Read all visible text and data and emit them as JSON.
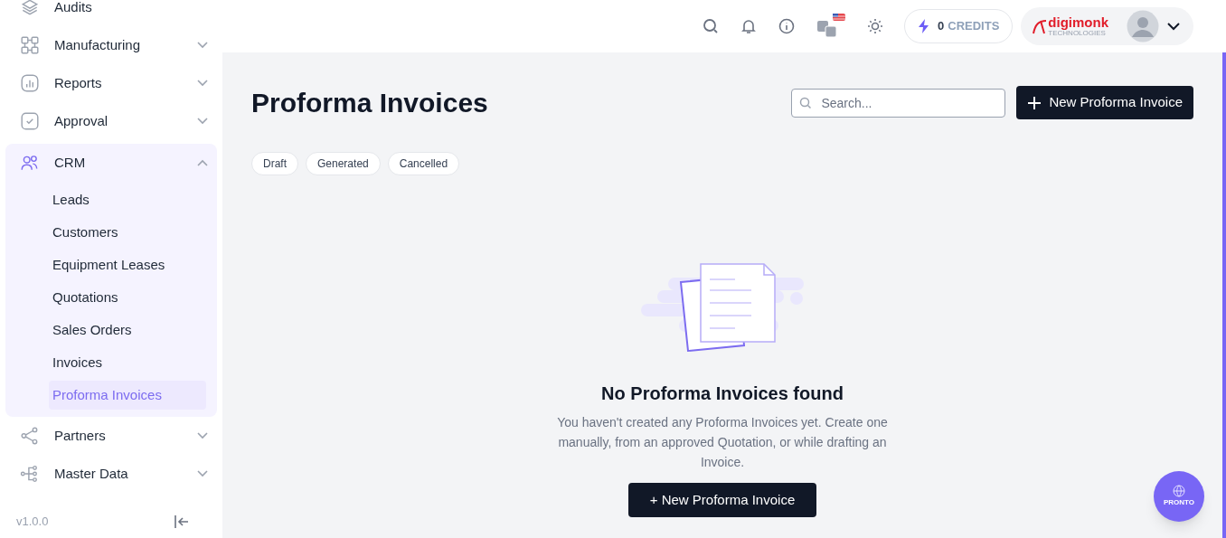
{
  "sidebar": {
    "items": [
      {
        "label": "Audits",
        "kind": "layers"
      },
      {
        "label": "Manufacturing",
        "kind": "grid",
        "expanded": false
      },
      {
        "label": "Reports",
        "kind": "chart",
        "expanded": false
      },
      {
        "label": "Approval",
        "kind": "check",
        "expanded": false
      },
      {
        "label": "CRM",
        "kind": "users",
        "expanded": true,
        "children": [
          {
            "label": "Leads",
            "selected": false
          },
          {
            "label": "Customers",
            "selected": false
          },
          {
            "label": "Equipment Leases",
            "selected": false
          },
          {
            "label": "Quotations",
            "selected": false
          },
          {
            "label": "Sales Orders",
            "selected": false
          },
          {
            "label": "Invoices",
            "selected": false
          },
          {
            "label": "Proforma Invoices",
            "selected": true
          }
        ]
      },
      {
        "label": "Partners",
        "kind": "share",
        "expanded": false
      },
      {
        "label": "Master Data",
        "kind": "tree",
        "expanded": false
      }
    ],
    "version": "v1.0.0"
  },
  "header": {
    "credits_count": "0",
    "credits_label": "CREDITS",
    "logo_text": "digimonk",
    "logo_subtext": "TECHNOLOGIES"
  },
  "page": {
    "title": "Proforma Invoices",
    "search": {
      "placeholder": "Search..."
    },
    "new_button": "New Proforma Invoice",
    "filters": [
      {
        "label": "Draft",
        "selected": false
      },
      {
        "label": "Generated",
        "selected": false
      },
      {
        "label": "Cancelled",
        "selected": false
      }
    ],
    "empty_state": {
      "title": "No Proforma Invoices found",
      "message": "You haven't created any Proforma Invoices yet. Create one manually, from an approved Quotation, or while drafting an Invoice.",
      "button": "+ New Proforma Invoice"
    }
  },
  "assistant": {
    "label": "PRONTO"
  }
}
